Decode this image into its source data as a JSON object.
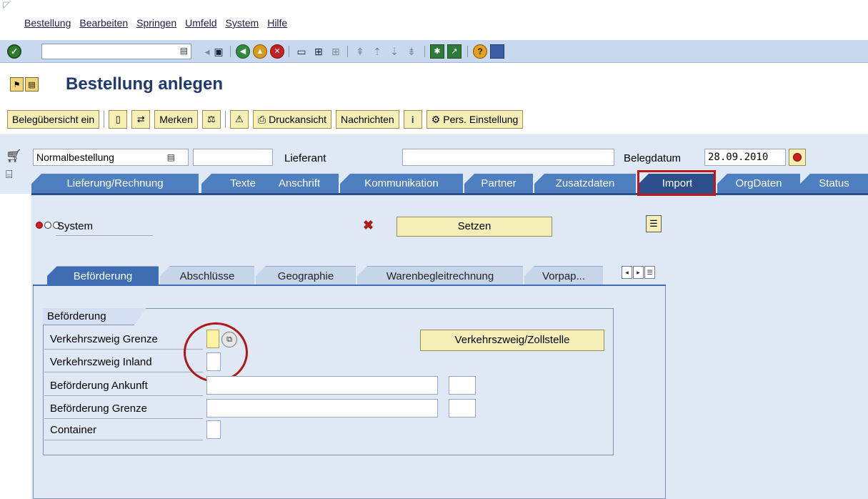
{
  "menu": [
    "Bestellung",
    "Bearbeiten",
    "Springen",
    "Umfeld",
    "System",
    "Hilfe"
  ],
  "toolbar": {
    "command_value": ""
  },
  "page": {
    "title": "Bestellung anlegen"
  },
  "appbar": {
    "overview": "Belegübersicht ein",
    "remember": "Merken",
    "print_preview": "Druckansicht",
    "messages": "Nachrichten",
    "personal_settings": "Pers. Einstellung"
  },
  "header": {
    "order_type": "Normalbestellung",
    "supplier_number": "",
    "supplier_label": "Lieferant",
    "supplier_name": "",
    "doc_date_label": "Belegdatum",
    "doc_date": "28.09.2010"
  },
  "header_tabs": [
    {
      "label": "Lieferung/Rechnung",
      "active": false
    },
    {
      "label": "Texte",
      "active": false
    },
    {
      "label": "Anschrift",
      "active": false
    },
    {
      "label": "Kommunikation",
      "active": false
    },
    {
      "label": "Partner",
      "active": false
    },
    {
      "label": "Zusatzdaten",
      "active": false
    },
    {
      "label": "Import",
      "active": true
    },
    {
      "label": "OrgDaten",
      "active": false
    },
    {
      "label": "Status",
      "active": false
    }
  ],
  "import": {
    "system_label": "System",
    "set_button": "Setzen",
    "sub_tabs": [
      {
        "label": "Beförderung",
        "active": true
      },
      {
        "label": "Abschlüsse",
        "active": false
      },
      {
        "label": "Geographie",
        "active": false
      },
      {
        "label": "Warenbegleitrechnung",
        "active": false
      },
      {
        "label": "Vorpap...",
        "active": false
      }
    ],
    "group_title": "Beförderung",
    "fields": {
      "mode_border": "Verkehrszweig Grenze",
      "mode_inland": "Verkehrszweig Inland",
      "transport_arrival": "Beförderung Ankunft",
      "transport_border": "Beförderung Grenze",
      "container": "Container"
    },
    "mode_button": "Verkehrszweig/Zollstelle"
  }
}
